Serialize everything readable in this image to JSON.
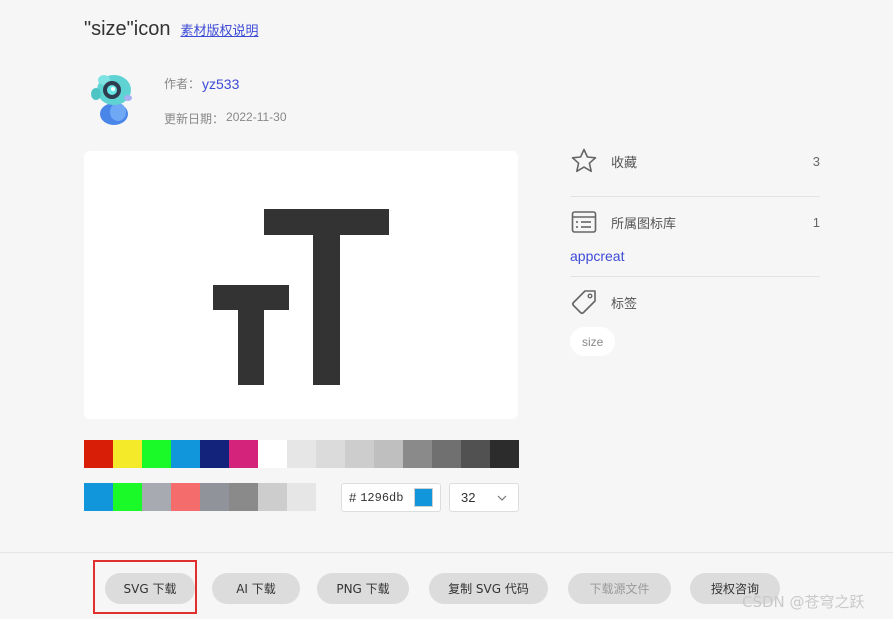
{
  "header": {
    "title": "\"size\"icon",
    "copyright_link": "素材版权说明"
  },
  "author": {
    "label": "作者：",
    "name": "yz533",
    "date_label": "更新日期：",
    "date": "2022-11-30"
  },
  "preview": {
    "icon": "text-size-icon",
    "icon_color": "#333333"
  },
  "palette": {
    "row1": [
      "#d81e06",
      "#f4ea2a",
      "#1afa29",
      "#1296db",
      "#13227a",
      "#d4237a",
      "#ffffff",
      "#e6e6e6",
      "#dbdbdb",
      "#cdcdcd",
      "#bfbfbf",
      "#8a8a8a",
      "#707070",
      "#515151",
      "#2c2c2c"
    ],
    "row2": [
      "#1296db",
      "#1afa29",
      "#a8aab2",
      "#f56c6c",
      "#90939a",
      "#8a8a8a",
      "#cdcdcd",
      "#e6e6e6"
    ]
  },
  "color_input": {
    "hash": "#",
    "value": "1296db",
    "swatch": "#1296db"
  },
  "size_select": {
    "value": "32"
  },
  "sidebar": {
    "collect": {
      "label": "收藏",
      "count": "3",
      "icon": "star-icon"
    },
    "library": {
      "label": "所属图标库",
      "count": "1",
      "icon": "library-icon",
      "link": "appcreat"
    },
    "tags": {
      "label": "标签",
      "icon": "tag-icon",
      "items": [
        "size"
      ]
    }
  },
  "actions": {
    "svg_download": "SVG 下载",
    "ai_download": "AI 下载",
    "png_download": "PNG 下载",
    "copy_svg": "复制 SVG 代码",
    "source_download": "下载源文件",
    "license": "授权咨询"
  },
  "watermark": "CSDN @苍穹之跃",
  "colors": {
    "link": "#3d4bd6",
    "highlight": "#e02f2f"
  }
}
